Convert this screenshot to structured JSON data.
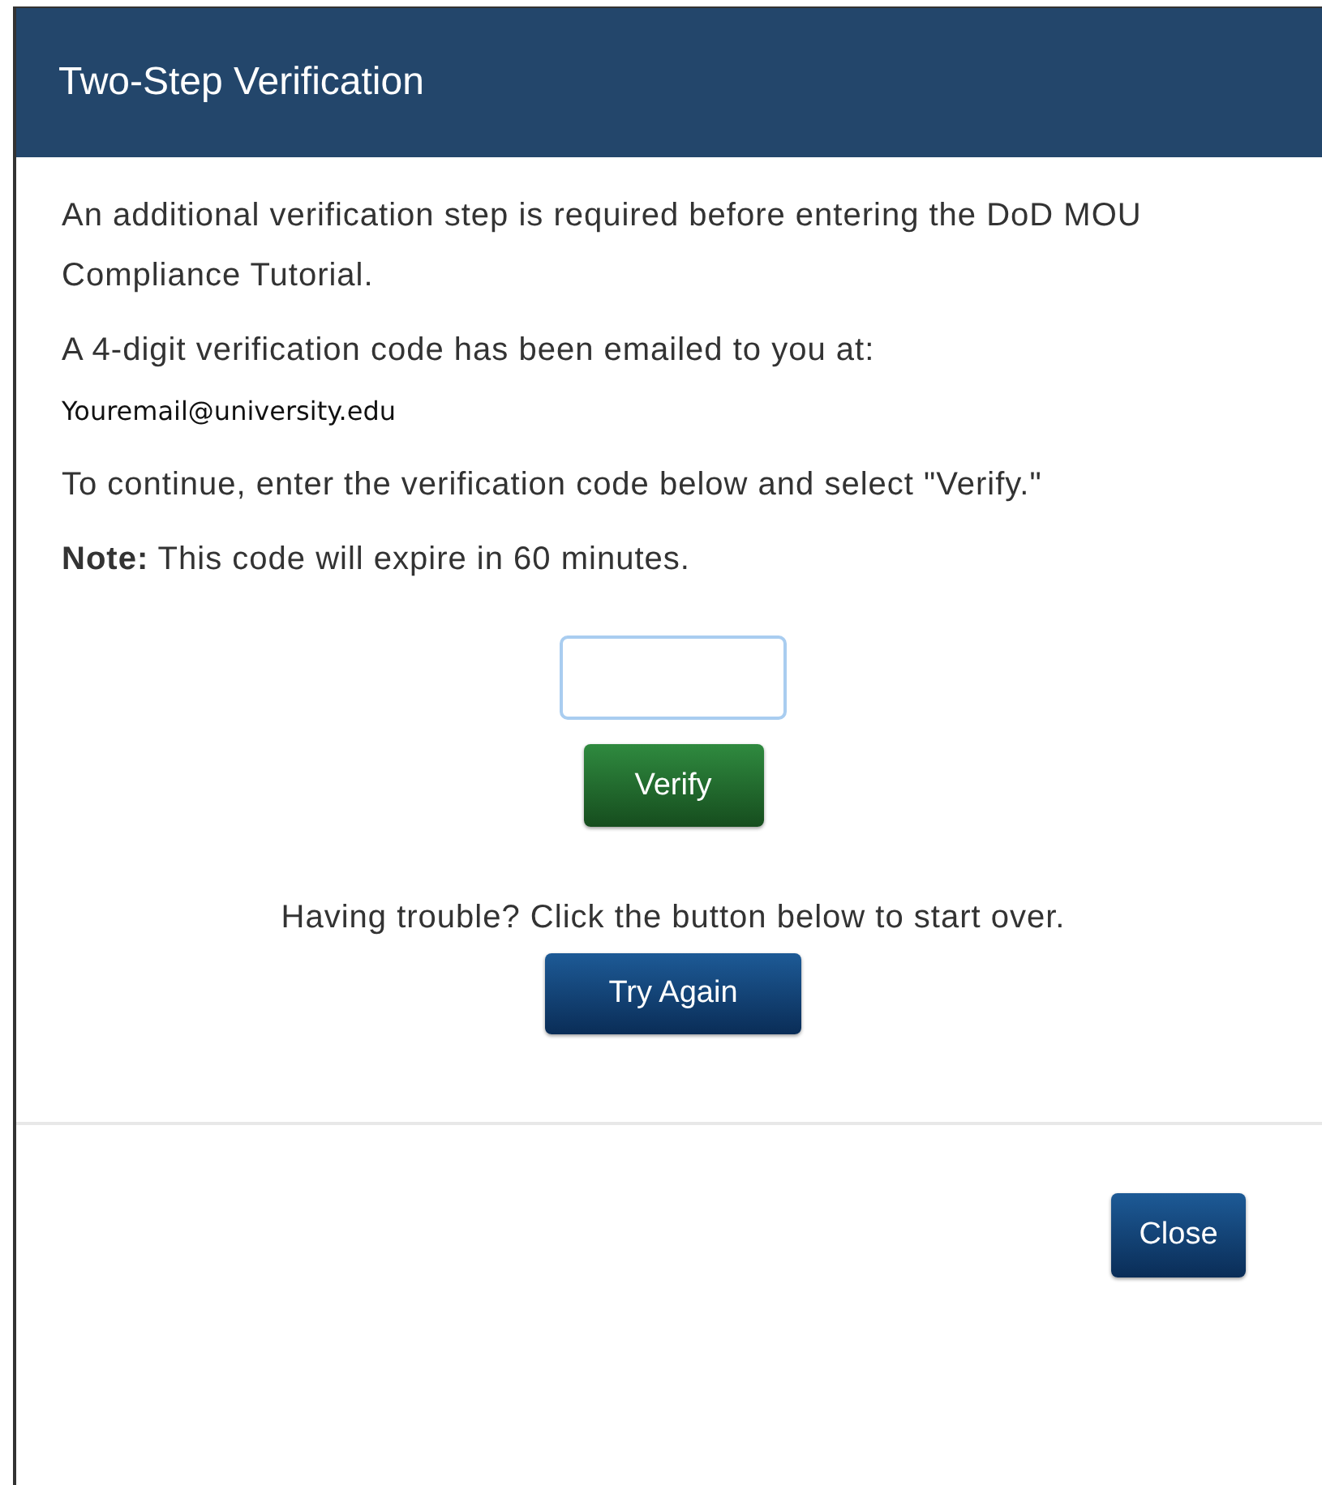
{
  "dialog": {
    "title": "Two-Step Verification",
    "paragraphs": [
      {
        "kind": "plain",
        "text": "An additional verification step is required before entering the DoD MOU Compliance Tutorial."
      },
      {
        "kind": "email",
        "text": "A 4-digit verification code has been emailed to you at:",
        "email": "Youremail@university.edu"
      },
      {
        "kind": "plain",
        "text": "To continue, enter the verification code below and select \"Verify.\""
      },
      {
        "kind": "plain",
        "text": "**Note:** This code will expire in 60 minutes."
      }
    ],
    "verify_button": "Verify",
    "trouble_text": "Having trouble? Click the button below to start over.",
    "try_again_button": "Try Again",
    "close_button": "Close"
  }
}
